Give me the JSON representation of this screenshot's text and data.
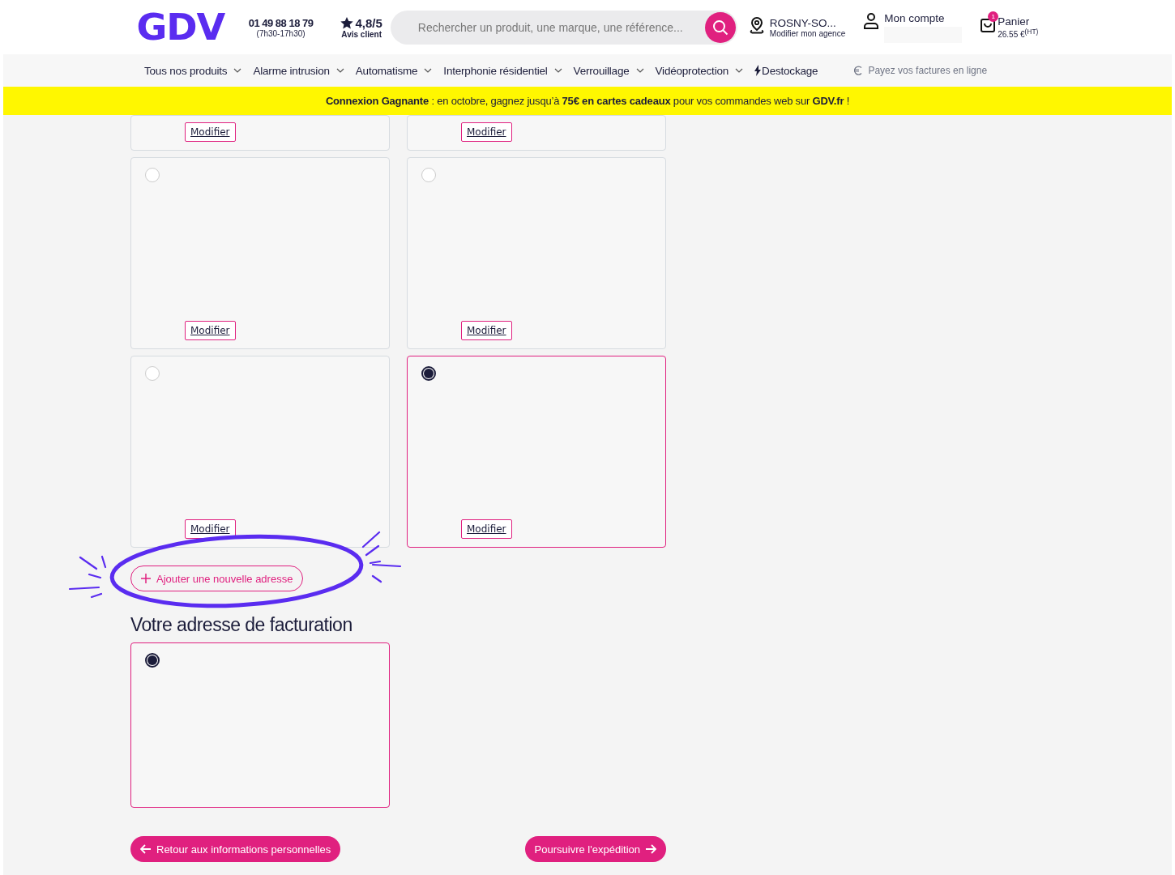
{
  "header": {
    "logo": "GDV",
    "phone": "01 49 88 18 79",
    "hours": "(7h30-17h30)",
    "rating": "4,8/5",
    "rating_label": "Avis client",
    "search": {
      "placeholder": "Rechercher un produit, une marque, une référence..."
    },
    "agency": {
      "name": "ROSNY-SO...",
      "link": "Modifier mon agence"
    },
    "account": {
      "label": "Mon compte"
    },
    "cart": {
      "label": "Panier",
      "total": "26.55 €$^{(HT)}$",
      "count": "1"
    }
  },
  "nav": {
    "items": [
      {
        "label": "Tous nos produits",
        "kind": "dropdown"
      },
      {
        "label": "Alarme intrusion",
        "kind": "dropdown"
      },
      {
        "label": "Automatisme",
        "kind": "dropdown"
      },
      {
        "label": "Interphonie résidentiel",
        "kind": "dropdown"
      },
      {
        "label": "Verrouillage",
        "kind": "dropdown"
      },
      {
        "label": "Vidéoprotection",
        "kind": "dropdown"
      },
      {
        "label": "Destockage",
        "kind": "flash"
      }
    ],
    "bill_link": "Payez vos factures en ligne"
  },
  "banner": "**Connexion Gagnante** : en octobre, gagnez jusqu’à **75€ en cartes cadeaux** pour vos commandes web sur **GDV.fr** !",
  "delivery_addresses": [
    {
      "kind": "partial",
      "modify_label": "Modifier"
    },
    {
      "kind": "partial",
      "modify_label": "Modifier"
    },
    {
      "kind": "full",
      "selected": false,
      "modify_label": "Modifier"
    },
    {
      "kind": "full",
      "selected": false,
      "modify_label": "Modifier"
    },
    {
      "kind": "full",
      "selected": false,
      "modify_label": "Modifier"
    },
    {
      "kind": "full",
      "selected": true,
      "modify_label": "Modifier"
    }
  ],
  "add_address_button": "Ajouter une nouvelle adresse",
  "billing": {
    "title": "Votre adresse de facturation",
    "addresses": [
      {
        "kind": "billing",
        "selected": true
      }
    ]
  },
  "actions": {
    "back": "Retour aux informations personnelles",
    "next": "Poursuivre l'expédition"
  }
}
